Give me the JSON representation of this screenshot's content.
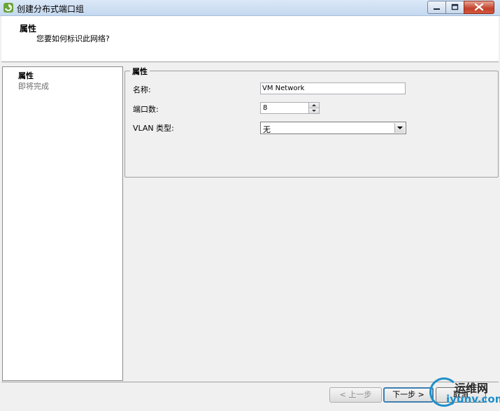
{
  "window": {
    "title": "创建分布式端口组",
    "icon": "vsphere-app-icon",
    "controls": {
      "minimize": "minimize-icon",
      "maximize": "maximize-icon",
      "close": "close-icon"
    }
  },
  "header": {
    "title": "属性",
    "subtitle": "您要如何标识此网络?"
  },
  "nav": {
    "items": [
      {
        "label": "属性",
        "state": "active"
      },
      {
        "label": "即将完成",
        "state": "pending"
      }
    ]
  },
  "properties": {
    "group_title": "属性",
    "name_label": "名称:",
    "name_value": "VM Network",
    "ports_label": "端口数:",
    "ports_value": "8",
    "vlan_label": "VLAN 类型:",
    "vlan_value": "无"
  },
  "footer": {
    "back_label": "< 上一步",
    "next_label": "下一步 >",
    "cancel_label": "取消"
  },
  "watermark": {
    "cn": "运维网",
    "en": "iyunv.com"
  },
  "colors": {
    "titlebar": "#c4d8ef",
    "close_button": "#c2412b",
    "default_button_border": "#3c7fb1",
    "watermark_accent": "#1f8fc9"
  }
}
